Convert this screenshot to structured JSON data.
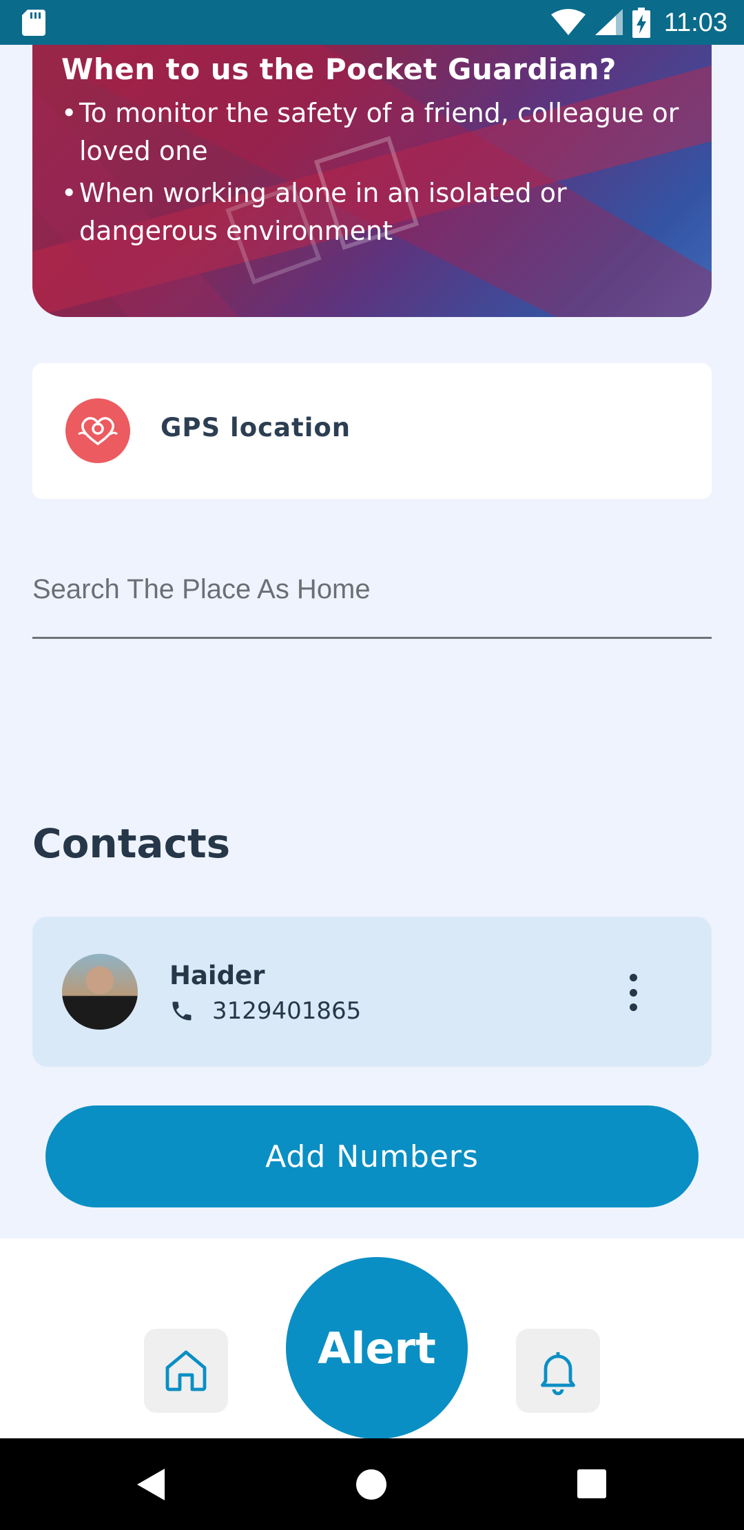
{
  "status_bar": {
    "time": "11:03",
    "icons": [
      "sd-card-icon",
      "wifi-icon",
      "signal-icon",
      "battery-charging-icon"
    ]
  },
  "banner": {
    "title": "When to us the Pocket Guardian?",
    "bullets": [
      "To monitor the safety of a friend, colleague or loved one",
      "When working alone in an isolated or dangerous environment"
    ]
  },
  "gps_card": {
    "icon": "location-heart-icon",
    "label": "GPS location",
    "icon_color": "#eb5b5f"
  },
  "search": {
    "placeholder": "Search The Place As Home",
    "value": ""
  },
  "contacts": {
    "title": "Contacts",
    "items": [
      {
        "name": "Haider",
        "phone": "3129401865",
        "icon": "phone-icon"
      }
    ]
  },
  "add_button": {
    "label": "Add Numbers"
  },
  "bottom_nav": {
    "home_icon": "home-icon",
    "alert_label": "Alert",
    "bell_icon": "bell-icon"
  },
  "colors": {
    "accent": "#0a8fc4",
    "status_bar": "#0a6b8b",
    "background": "#eff3fd",
    "contact_card": "#dae9f7"
  }
}
